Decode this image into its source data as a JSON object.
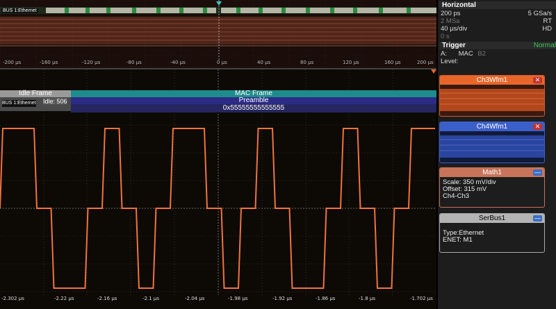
{
  "overview": {
    "bus_label": "BUS 1:Ethernet",
    "ticks": [
      "-200 µs",
      "-160 µs",
      "-120 µs",
      "-80 µs",
      "-40 µs",
      "0 µs",
      "40 µs",
      "80 µs",
      "120 µs",
      "160 µs",
      "200 µs"
    ],
    "trace_color": "#e8744a"
  },
  "decode": {
    "bus_label": "BUS 1:Ethernet",
    "idle_frame": "Idle Frame",
    "idle_value": "Idle: 506",
    "mac_frame": "MAC Frame",
    "preamble": "Preamble",
    "preamble_value": "0x55555555555555"
  },
  "time_axis": {
    "ticks": [
      "-2.302 µs",
      "-2.22 µs",
      "-2.16 µs",
      "-2.1 µs",
      "-2.04 µs",
      "-1.98 µs",
      "-1.92 µs",
      "-1.86 µs",
      "-1.8 µs",
      "-1.702 µs"
    ]
  },
  "horizontal": {
    "title": "Horizontal",
    "resolution": "200 ps",
    "sample_rate": "5 GSa/s",
    "record_length": "2 MSa",
    "mode": "RT",
    "time_scale": "40 µs/div",
    "hd": "HD",
    "position": "0 s"
  },
  "trigger": {
    "title": "Trigger",
    "mode": "Normal",
    "source_prefix": "A:",
    "source": "MAC",
    "value": "B2",
    "level_label": "Level:"
  },
  "windows": {
    "ch3": {
      "title": "Ch3Wfm1",
      "color": "#e8662a"
    },
    "ch4": {
      "title": "Ch4Wfm1",
      "color": "#3b5fc8"
    },
    "math": {
      "title": "Math1",
      "scale": "Scale:  350 mV/div",
      "offset": "Offset: 315 mV",
      "expr": "Ch4-Ch3"
    },
    "serbus": {
      "title": "SerBus1",
      "type": "Type:Ethernet",
      "enet": "ENET: M1"
    }
  },
  "colors": {
    "waveform": "#f0743c",
    "grid": "#4a4a3a",
    "decode_teal": "#1e8c8c",
    "decode_blue": "#2c2c86",
    "idle_gray": "#9a9a9a"
  }
}
